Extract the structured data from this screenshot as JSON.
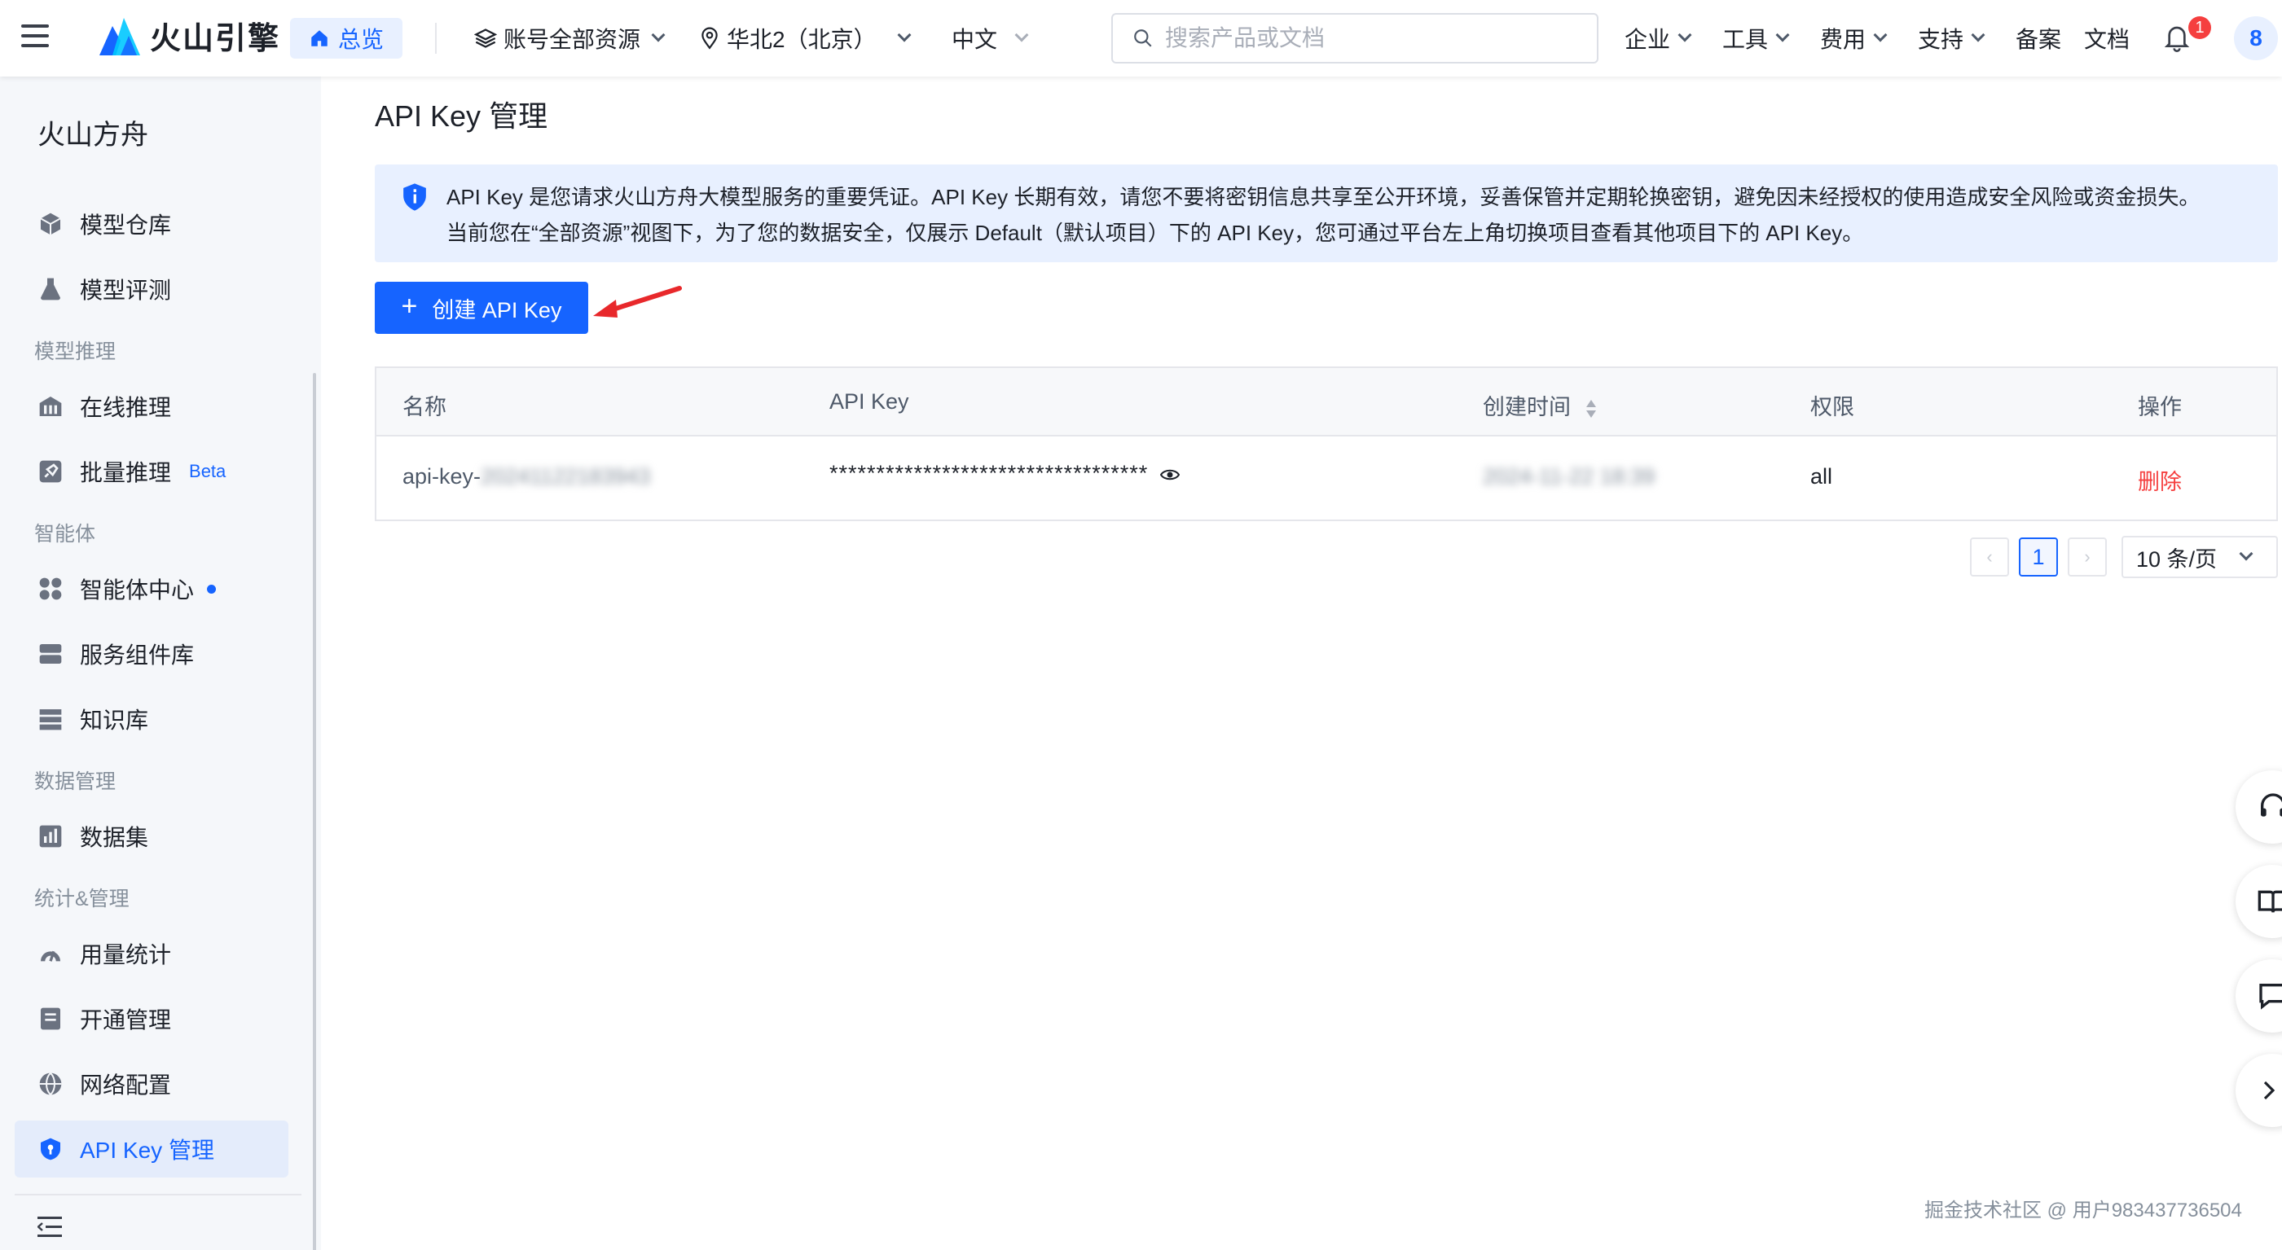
{
  "header": {
    "logo_text": "火山引擎",
    "overview_label": "总览",
    "account_label": "账号全部资源",
    "region_label": "华北2（北京）",
    "language_label": "中文",
    "search_placeholder": "搜索产品或文档",
    "menu": [
      "企业",
      "工具",
      "费用",
      "支持",
      "备案",
      "文档"
    ],
    "notification_count": "1",
    "avatar_text": "8"
  },
  "sidebar": {
    "title": "火山方舟",
    "items": {
      "model_repo": "模型仓库",
      "model_eval": "模型评测",
      "online_infer": "在线推理",
      "batch_infer": "批量推理",
      "batch_badge": "Beta",
      "agent_center": "智能体中心",
      "service_lib": "服务组件库",
      "knowledge": "知识库",
      "dataset": "数据集",
      "usage": "用量统计",
      "activation": "开通管理",
      "network": "网络配置",
      "apikey": "API Key 管理"
    },
    "groups": {
      "infer": "模型推理",
      "agent": "智能体",
      "data": "数据管理",
      "stats": "统计&管理"
    }
  },
  "main": {
    "title": "API Key 管理",
    "notice_line1": "API Key 是您请求火山方舟大模型服务的重要凭证。API Key 长期有效，请您不要将密钥信息共享至公开环境，妥善保管并定期轮换密钥，避免因未经授权的使用造成安全风险或资金损失。",
    "notice_line2": "当前您在“全部资源”视图下，为了您的数据安全，仅展示 Default（默认项目）下的 API Key，您可通过平台左上角切换项目查看其他项目下的 API Key。",
    "create_button": "创建 API Key",
    "table": {
      "headers": {
        "name": "名称",
        "key": "API Key",
        "created": "创建时间",
        "permission": "权限",
        "action": "操作"
      },
      "rows": [
        {
          "name_prefix": "api-key-",
          "name_suffix": "20241122183943",
          "key": "**********************************",
          "created": "2024-11-22 18:39",
          "permission": "all",
          "action": "删除"
        }
      ]
    },
    "pagination": {
      "prev": "‹",
      "current": "1",
      "next": "›",
      "page_size": "10 条/页"
    }
  },
  "watermark": "掘金技术社区 @ 用户983437736504",
  "colors": {
    "primary": "#1664ff",
    "danger": "#f53f3f",
    "notice_bg": "#e8f0ff",
    "sidebar_bg": "#f5f7fa"
  }
}
